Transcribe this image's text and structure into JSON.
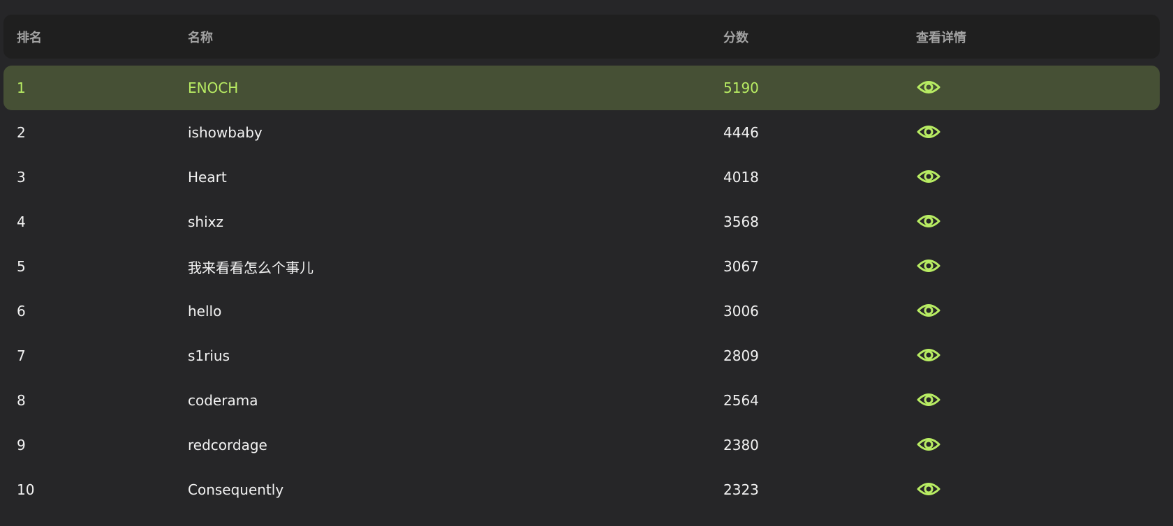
{
  "headers": {
    "rank": "排名",
    "name": "名称",
    "score": "分数",
    "view": "查看详情"
  },
  "accent_color": "#b8ec63",
  "highlight_bg": "#465035",
  "view_icon": "eye-icon",
  "rows": [
    {
      "rank": "1",
      "name": "ENOCH",
      "score": "5190"
    },
    {
      "rank": "2",
      "name": "ishowbaby",
      "score": "4446"
    },
    {
      "rank": "3",
      "name": "Heart",
      "score": "4018"
    },
    {
      "rank": "4",
      "name": "shixz",
      "score": "3568"
    },
    {
      "rank": "5",
      "name": "我来看看怎么个事儿",
      "score": "3067"
    },
    {
      "rank": "6",
      "name": "hello",
      "score": "3006"
    },
    {
      "rank": "7",
      "name": "s1rius",
      "score": "2809"
    },
    {
      "rank": "8",
      "name": "coderama",
      "score": "2564"
    },
    {
      "rank": "9",
      "name": "redcordage",
      "score": "2380"
    },
    {
      "rank": "10",
      "name": "Consequently",
      "score": "2323"
    }
  ]
}
